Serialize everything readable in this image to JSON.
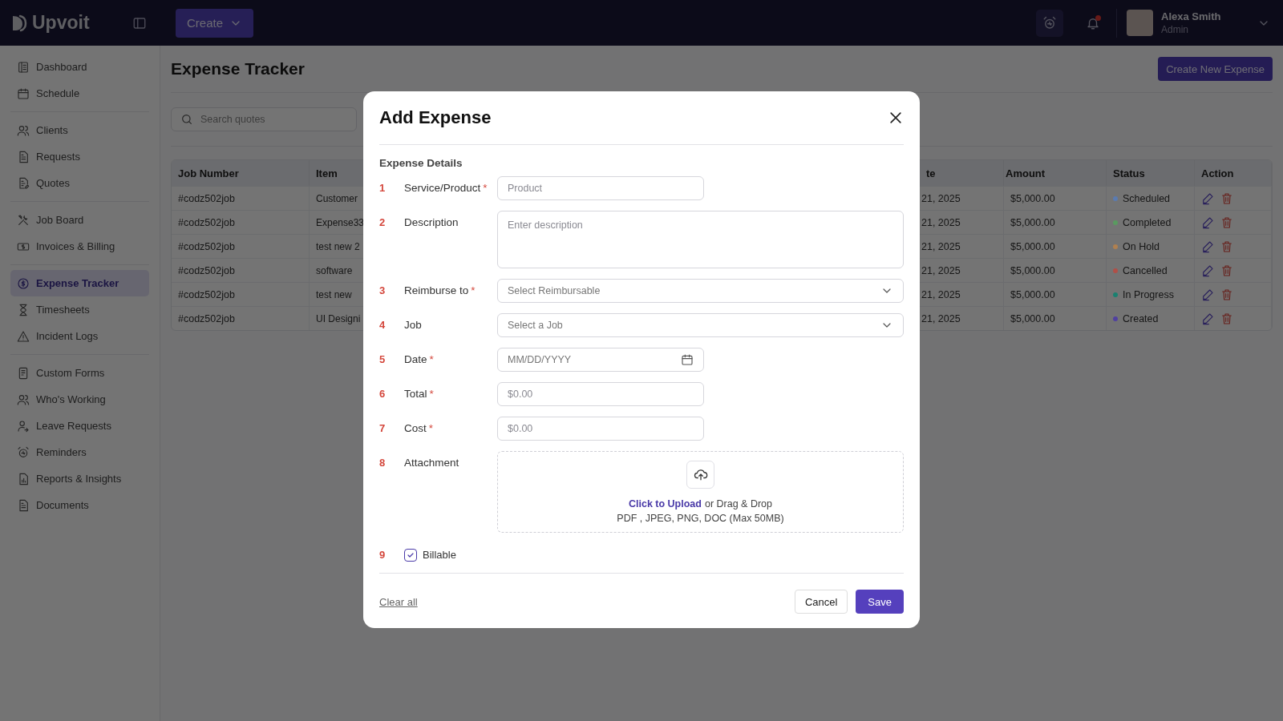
{
  "app": {
    "logo": "Upvoit",
    "create_button": "Create"
  },
  "user": {
    "name": "Alexa Smith",
    "role": "Admin",
    "has_notifications": true
  },
  "sidebar": {
    "groups": [
      {
        "items": [
          {
            "label": "Dashboard",
            "selected": false
          },
          {
            "label": "Schedule",
            "selected": false
          }
        ]
      },
      {
        "items": [
          {
            "label": "Clients",
            "selected": false
          },
          {
            "label": "Requests",
            "selected": false
          },
          {
            "label": "Quotes",
            "selected": false
          }
        ]
      },
      {
        "items": [
          {
            "label": "Job Board",
            "selected": false
          },
          {
            "label": "Invoices & Billing",
            "selected": false
          }
        ]
      },
      {
        "items": [
          {
            "label": "Expense Tracker",
            "selected": true
          },
          {
            "label": "Timesheets",
            "selected": false
          },
          {
            "label": "Incident Logs",
            "selected": false
          }
        ]
      },
      {
        "items": [
          {
            "label": "Custom Forms",
            "selected": false
          },
          {
            "label": "Who's Working",
            "selected": false
          },
          {
            "label": "Leave Requests",
            "selected": false
          },
          {
            "label": "Reminders",
            "selected": false
          },
          {
            "label": "Reports & Insights",
            "selected": false
          },
          {
            "label": "Documents",
            "selected": false
          }
        ]
      }
    ]
  },
  "page": {
    "title": "Expense Tracker",
    "primary_button": "Create New Expense",
    "search": {
      "placeholder": "Search quotes"
    }
  },
  "table": {
    "columns": [
      "Job Number",
      "Item",
      "te",
      "Amount",
      "Status",
      "Action"
    ],
    "rows": [
      {
        "job_number": "#codz502job",
        "item": "Customer",
        "date": "21, 2025",
        "amount": "$5,000.00",
        "status": "Scheduled",
        "color": "#5b7bb0"
      },
      {
        "job_number": "#codz502job",
        "item": "Expense33",
        "date": "21, 2025",
        "amount": "$5,000.00",
        "status": "Completed",
        "color": "#5a9a60"
      },
      {
        "job_number": "#codz502job",
        "item": "test new 2",
        "date": "21, 2025",
        "amount": "$5,000.00",
        "status": "On Hold",
        "color": "#b08050"
      },
      {
        "job_number": "#codz502job",
        "item": "software",
        "date": "21, 2025",
        "amount": "$5,000.00",
        "status": "Cancelled",
        "color": "#b05048"
      },
      {
        "job_number": "#codz502job",
        "item": "test new",
        "date": "21, 2025",
        "amount": "$5,000.00",
        "status": "In Progress",
        "color": "#1a8070"
      },
      {
        "job_number": "#codz502job",
        "item": "UI Designi",
        "date": "21, 2025",
        "amount": "$5,000.00",
        "status": "Created",
        "color": "#5040a0"
      }
    ]
  },
  "modal": {
    "title": "Add Expense",
    "section": "Expense Details",
    "fields": [
      {
        "number": "1",
        "label": "Service/Product",
        "required_mark": "*",
        "kind": "text",
        "placeholder": "Product"
      },
      {
        "number": "2",
        "label": "Description",
        "kind": "textarea",
        "placeholder": "Enter description"
      },
      {
        "number": "3",
        "label": "Reimburse to",
        "required_mark": "*",
        "kind": "select",
        "placeholder": "Select Reimbursable"
      },
      {
        "number": "4",
        "label": "Job",
        "kind": "select",
        "placeholder": "Select a Job"
      },
      {
        "number": "5",
        "label": "Date",
        "required_mark": "*",
        "kind": "date",
        "placeholder": "MM/DD/YYYY"
      },
      {
        "number": "6",
        "label": "Total",
        "required_mark": "*",
        "kind": "text",
        "placeholder": "$0.00"
      },
      {
        "number": "7",
        "label": "Cost",
        "required_mark": "*",
        "kind": "text",
        "placeholder": "$0.00"
      },
      {
        "number": "8",
        "label": "Attachment",
        "kind": "upload",
        "link": "Click to Upload",
        "text": "or Drag & Drop",
        "hint": "PDF , JPEG, PNG, DOC (Max 50MB)"
      },
      {
        "number": "9",
        "label": "Billable",
        "kind": "checkbox",
        "checked": true
      }
    ],
    "clear_button": "Clear all",
    "cancel_button": "Cancel",
    "save_button": "Save"
  }
}
